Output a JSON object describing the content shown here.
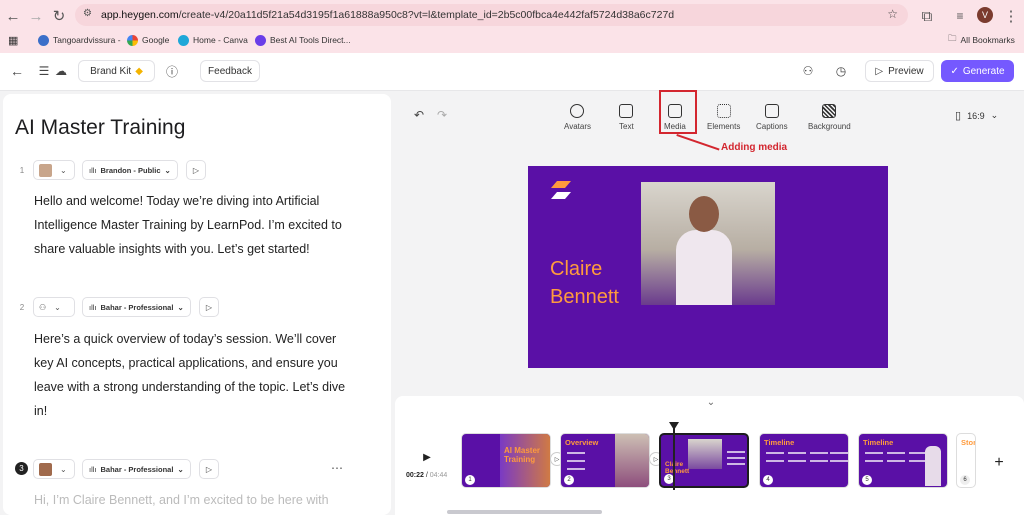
{
  "browser": {
    "url_host": "app.heygen.com",
    "url_path": "/create-v4/20a11d5f21a54d3195f1a61888a950c8?vt=l&template_id=2b5c00fbca4e442faf5724d38a6c727d",
    "avatar_letter": "V",
    "bookmarks": [
      "Tangoardvissura -",
      "Google",
      "Home - Canva",
      "Best AI Tools Direct..."
    ],
    "all_bookmarks": "All Bookmarks"
  },
  "toolbar": {
    "brand_kit": "Brand Kit",
    "feedback": "Feedback",
    "preview": "Preview",
    "generate": "Generate"
  },
  "script": {
    "title": "AI Master Training",
    "scenes": [
      {
        "num": "1",
        "voice": "Brandon - Public",
        "text": "Hello and welcome! Today we’re diving into Artificial Intelligence Master Training by LearnPod. I’m excited to share valuable insights with you. Let’s get started!"
      },
      {
        "num": "2",
        "voice": "Bahar - Professional",
        "text": "Here’s a quick overview of today’s session. We’ll cover key AI concepts, practical applications, and ensure you leave with a strong understanding of the topic. Let’s dive in!"
      },
      {
        "num": "3",
        "voice": "Bahar - Professional",
        "text": "Hi, I’m Claire Bennett, and I’m excited to be here with"
      }
    ]
  },
  "editor": {
    "tools": [
      "Avatars",
      "Text",
      "Media",
      "Elements",
      "Captions",
      "Background"
    ],
    "annotation": "Adding media",
    "aspect_ratio": "16:9",
    "slide_name_first": "Claire",
    "slide_name_last": "Bennett"
  },
  "timeline": {
    "current_time": "00:22",
    "total_time": "04:44",
    "thumbs": [
      {
        "num": "1",
        "title": "AI Master Training"
      },
      {
        "num": "2",
        "title": "Overview"
      },
      {
        "num": "3",
        "title": "Claire Bennett"
      },
      {
        "num": "4",
        "title": "Timeline"
      },
      {
        "num": "5",
        "title": "Timeline"
      },
      {
        "num": "6",
        "title": "Story"
      }
    ]
  },
  "colors": {
    "accent": "#7559ff",
    "slide_bg": "#5a10a6",
    "slide_text": "#ff9b3d",
    "annotation": "#d3262f"
  }
}
